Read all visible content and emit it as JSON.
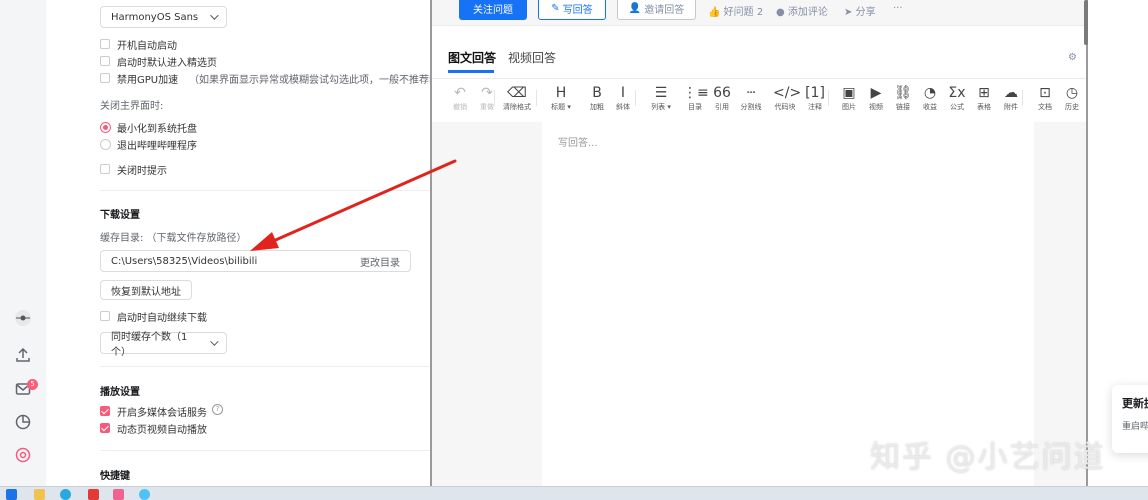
{
  "settings": {
    "font_select": "HarmonyOS Sans",
    "startup_items": [
      {
        "label": "开机自动启动",
        "checked": false
      },
      {
        "label": "启动时默认进入精选页",
        "checked": false
      },
      {
        "label": "禁用GPU加速",
        "checked": false
      }
    ],
    "gpu_hint": "（如果界面显示异常或模糊尝试勾选此项，一般不推荐禁",
    "close_main_label": "关闭主界面时:",
    "close_options": [
      {
        "label": "最小化到系统托盘",
        "selected": true
      },
      {
        "label": "退出哔哩哔哩程序",
        "selected": false
      }
    ],
    "close_prompt_label": "关闭时提示",
    "download": {
      "title": "下载设置",
      "cache_label": "缓存目录: （下载文件存放路径）",
      "path": "C:\\Users\\58325\\Videos\\bilibili",
      "change_dir": "更改目录",
      "restore_default": "恢复到默认地址",
      "auto_resume": "启动时自动继续下载",
      "concurrent_select": "同时缓存个数（1个）"
    },
    "playback": {
      "title": "播放设置",
      "items": [
        {
          "label": "开启多媒体会话服务",
          "checked": true
        },
        {
          "label": "动态页视频自动播放",
          "checked": true
        }
      ]
    },
    "shortcuts_title": "快捷键"
  },
  "leftbar": {
    "icons": [
      "avatar-icon",
      "upload-icon",
      "mail-icon",
      "history-icon",
      "settings-icon"
    ],
    "mail_badge": "5"
  },
  "editor": {
    "follow_button": "关注问题",
    "write_button": "写回答",
    "invite_button": "邀请回答",
    "good_question": "好问题 2",
    "add_comment": "添加评论",
    "share": "分享",
    "more": "···",
    "tabs": [
      "图文回答",
      "视频回答"
    ],
    "placeholder": "写回答...",
    "toolbar": [
      {
        "glyph": "↶",
        "label": "撤销",
        "icon": "undo-icon",
        "dim": true
      },
      {
        "glyph": "↷",
        "label": "重做",
        "icon": "redo-icon",
        "dim": true
      },
      {
        "glyph": "⌫",
        "label": "清除格式",
        "icon": "eraser-icon",
        "dim": false
      },
      {
        "glyph": "H",
        "label": "标题 ▾",
        "icon": "heading-icon",
        "dim": false
      },
      {
        "glyph": "B",
        "label": "加粗",
        "icon": "bold-icon",
        "dim": false
      },
      {
        "glyph": "I",
        "label": "斜体",
        "icon": "italic-icon",
        "dim": false
      },
      {
        "glyph": "☰",
        "label": "列表 ▾",
        "icon": "list-icon",
        "dim": false
      },
      {
        "glyph": "⋮≡",
        "label": "目录",
        "icon": "toc-icon",
        "dim": false
      },
      {
        "glyph": "66",
        "label": "引用",
        "icon": "quote-icon",
        "dim": false
      },
      {
        "glyph": "┄",
        "label": "分割线",
        "icon": "divider-icon",
        "dim": false
      },
      {
        "glyph": "</>",
        "label": "代码块",
        "icon": "code-icon",
        "dim": false
      },
      {
        "glyph": "[1]",
        "label": "注释",
        "icon": "footnote-icon",
        "dim": false
      },
      {
        "glyph": "▣",
        "label": "图片",
        "icon": "image-icon",
        "dim": false
      },
      {
        "glyph": "▶",
        "label": "视频",
        "icon": "video-icon",
        "dim": false
      },
      {
        "glyph": "⛓",
        "label": "链接",
        "icon": "link-icon",
        "dim": false
      },
      {
        "glyph": "◔",
        "label": "收益",
        "icon": "income-icon",
        "dim": false
      },
      {
        "glyph": "Σx",
        "label": "公式",
        "icon": "formula-icon",
        "dim": false
      },
      {
        "glyph": "⊞",
        "label": "表格",
        "icon": "table-icon",
        "dim": false
      },
      {
        "glyph": "☁",
        "label": "附件",
        "icon": "attachment-icon",
        "dim": false
      },
      {
        "glyph": "⊡",
        "label": "文档",
        "icon": "document-icon",
        "dim": false
      },
      {
        "glyph": "◷",
        "label": "历史",
        "icon": "history-icon",
        "dim": false
      }
    ]
  },
  "notify": {
    "title": "更新提",
    "body": "重启哔"
  },
  "watermark": "知乎 @小艺问道",
  "colors": {
    "bili_pink": "#f85a7b",
    "zhihu_blue": "#1772f6",
    "arrow_red": "#e0231d"
  }
}
